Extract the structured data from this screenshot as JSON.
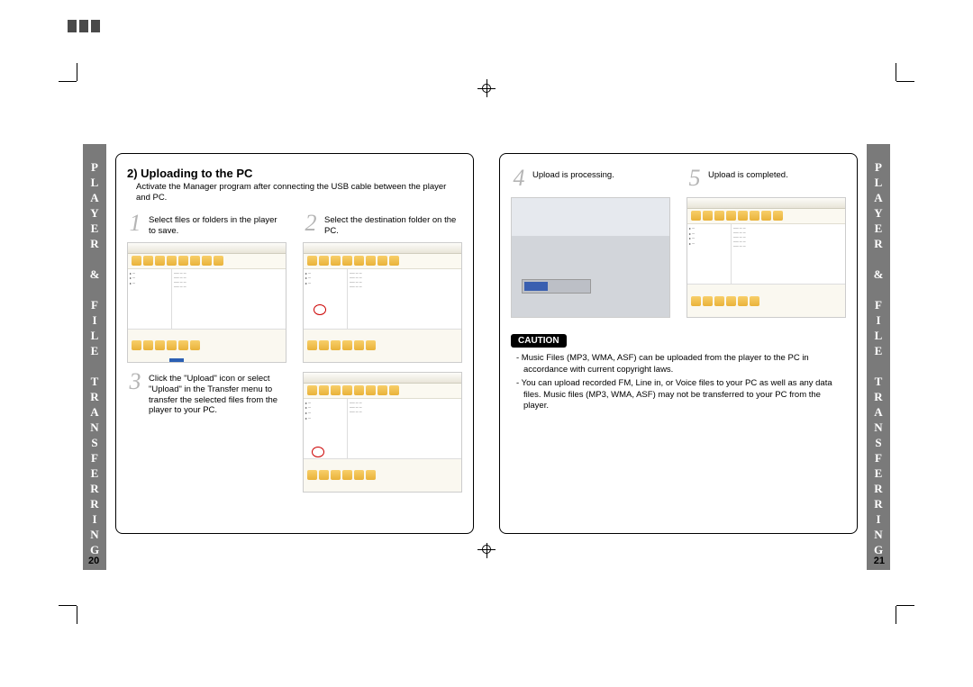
{
  "side_tab": "PLAYER & FILE TRANSFERRING",
  "left_page": {
    "number": "20",
    "title": "2) Uploading to the PC",
    "subtitle": "Activate the Manager program after connecting the USB cable between the player and PC.",
    "steps": {
      "s1": {
        "num": "1",
        "text": "Select files or folders in the player to save."
      },
      "s2": {
        "num": "2",
        "text": "Select the destination folder on the PC."
      },
      "s3": {
        "num": "3",
        "text": "Click the \"Upload\" icon or select \"Upload\" in the Transfer menu to transfer the selected files from the player to your PC."
      }
    }
  },
  "right_page": {
    "number": "21",
    "steps": {
      "s4": {
        "num": "4",
        "text": "Upload is processing."
      },
      "s5": {
        "num": "5",
        "text": "Upload is completed."
      }
    },
    "caution_label": "CAUTION",
    "caution_items": {
      "c1": "- Music Files (MP3, WMA, ASF) can be uploaded from the player to the PC in accordance with current copyright laws.",
      "c2": "- You can upload recorded FM, Line in, or Voice files to your PC as well as any data files. Music files (MP3, WMA, ASF) may not be transferred to your PC from the player."
    }
  }
}
